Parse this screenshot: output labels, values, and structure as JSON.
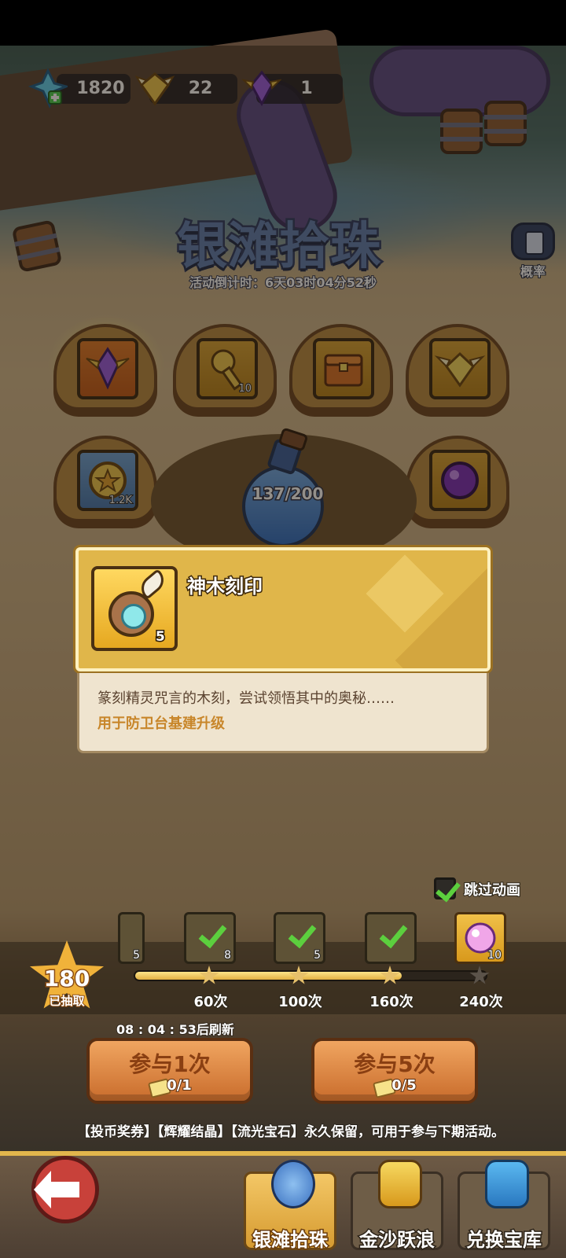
{
  "resources": [
    {
      "icon": "crystal-plus-icon",
      "value": "1820"
    },
    {
      "icon": "gold-gem-icon",
      "value": "22"
    },
    {
      "icon": "purple-gem-icon",
      "value": "1"
    }
  ],
  "event": {
    "title": "银滩拾珠",
    "countdown": "活动倒计时：6天03时04分52秒",
    "probability_label": "概率"
  },
  "prize_grid": {
    "row1": [
      {
        "icon": "purple-winged-gem-icon",
        "count": ""
      },
      {
        "icon": "key-icon",
        "count": "10"
      },
      {
        "icon": "treasure-chest-icon",
        "count": ""
      },
      {
        "icon": "gold-winged-gem-icon",
        "count": ""
      }
    ],
    "row2": [
      {
        "icon": "star-coin-icon",
        "count": "1.2K"
      },
      {
        "icon": "purple-pearl-icon",
        "count": ""
      }
    ],
    "bottle_progress": "137/200"
  },
  "item_popup": {
    "name": "神木刻印",
    "count": "5",
    "description": "篆刻精灵咒言的木刻，尝试领悟其中的奥秘……",
    "usage": "用于防卫台基建升级"
  },
  "skip_animation": {
    "label": "跳过动画",
    "checked": true
  },
  "milestones": {
    "drawn_count": "180",
    "drawn_label": "已抽取",
    "progress_fraction": 0.76,
    "items": [
      {
        "label": "60次",
        "reward_count": "8",
        "claimed": true,
        "reward_icon": "check-icon"
      },
      {
        "label": "100次",
        "reward_count": "5",
        "claimed": true,
        "reward_icon": "check-icon"
      },
      {
        "label": "160次",
        "reward_count": "",
        "claimed": true,
        "reward_icon": "check-icon"
      },
      {
        "label": "240次",
        "reward_count": "10",
        "claimed": false,
        "reward_icon": "pink-pearl-icon"
      }
    ],
    "partial_left": {
      "label": "",
      "reward_count": "5"
    }
  },
  "refresh_text": "08 : 04 : 53后刷新",
  "actions": [
    {
      "label": "参与1次",
      "cost": "0/1"
    },
    {
      "label": "参与5次",
      "cost": "0/5"
    }
  ],
  "notice": "【投币奖券】【辉耀结晶】【流光宝石】永久保留，可用于参与下期活动。",
  "nav": {
    "tabs": [
      {
        "label": "银滩拾珠",
        "icon": "bottle-icon",
        "active": true
      },
      {
        "label": "金沙跃浪",
        "icon": "gold-crown-icon",
        "active": false
      },
      {
        "label": "兑换宝库",
        "icon": "treasure-basket-icon",
        "active": false
      }
    ]
  },
  "colors": {
    "accent_gold": "#e0b64a",
    "title_blue": "#5f7db0",
    "action_orange": "#e08b48",
    "check_green": "#5ccf3e"
  }
}
